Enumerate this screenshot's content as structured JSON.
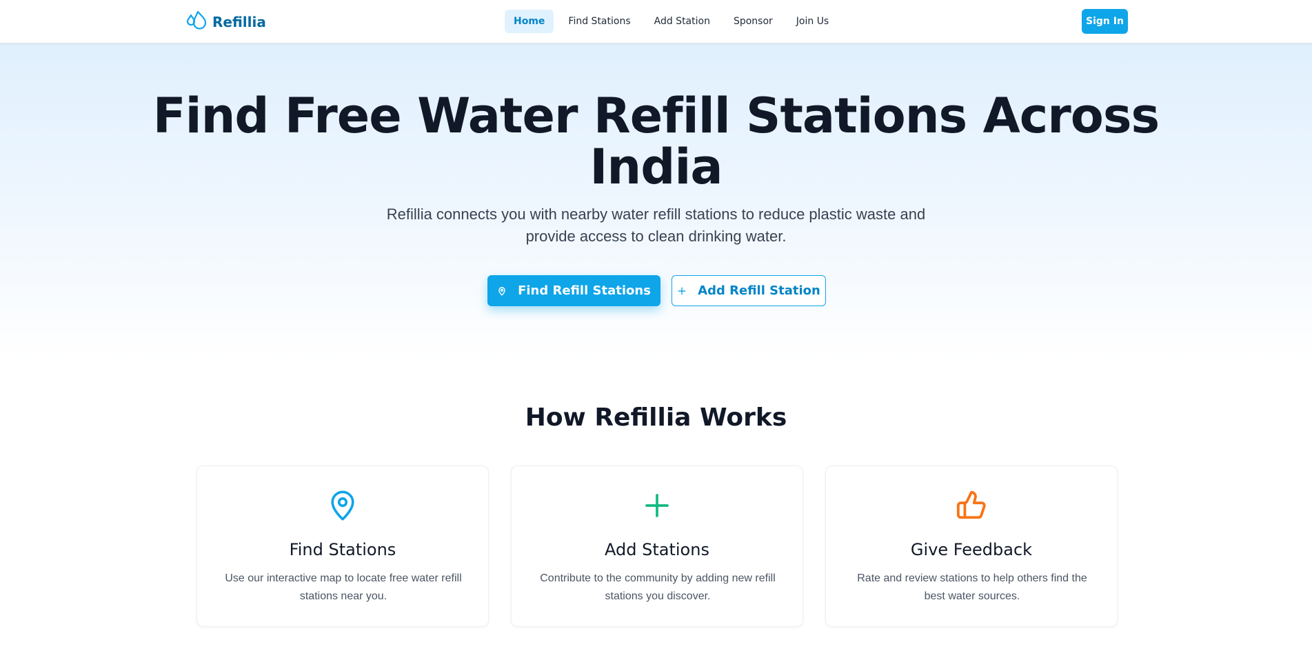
{
  "nav": {
    "brand": "Refillia",
    "links": [
      {
        "label": "Home",
        "active": true
      },
      {
        "label": "Find Stations",
        "active": false
      },
      {
        "label": "Add Station",
        "active": false
      },
      {
        "label": "Sponsor",
        "active": false
      },
      {
        "label": "Join Us",
        "active": false
      }
    ],
    "signin_label": "Sign In"
  },
  "hero": {
    "title_line1": "Find Free Water Refill Stations Across",
    "title_line2": "India",
    "subtitle": "Refillia connects you with nearby water refill stations to reduce plastic waste and provide access to clean drinking water.",
    "primary_button": "Find Refill Stations",
    "secondary_button": "Add Refill Station"
  },
  "how": {
    "title": "How Refillia Works",
    "cards": [
      {
        "icon": "map-pin-icon",
        "color": "#0ea5e9",
        "title": "Find Stations",
        "desc": "Use our interactive map to locate free water refill stations near you."
      },
      {
        "icon": "plus-icon",
        "color": "#10b981",
        "title": "Add Stations",
        "desc": "Contribute to the community by adding new refill stations you discover."
      },
      {
        "icon": "thumbs-up-icon",
        "color": "#f97316",
        "title": "Give Feedback",
        "desc": "Rate and review stations to help others find the best water sources."
      }
    ]
  },
  "colors": {
    "accent": "#0ea5e9",
    "brand_text": "#0369a1",
    "green": "#10b981",
    "orange": "#f97316",
    "heading": "#111827"
  }
}
